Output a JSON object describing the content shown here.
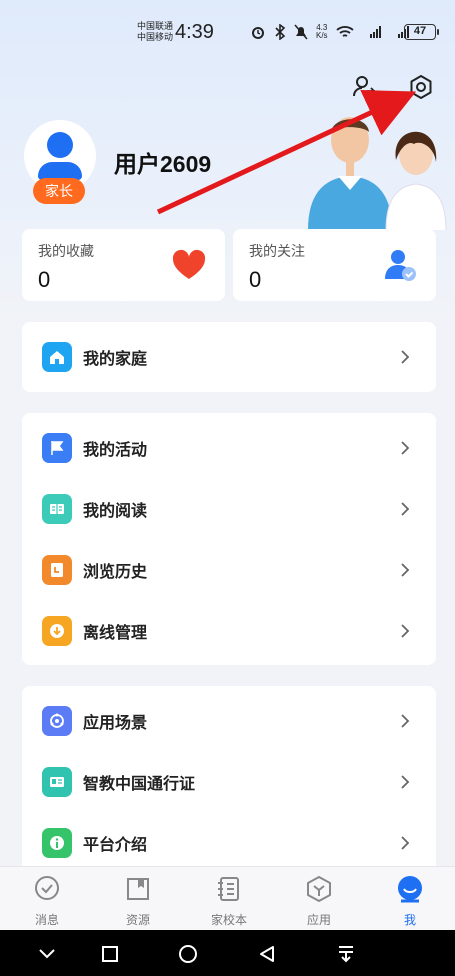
{
  "status_bar": {
    "carrier_top": "中国联通",
    "carrier_bottom": "中国移动",
    "time": "4:39",
    "speed_value": "4.3",
    "speed_unit": "K/s",
    "battery": "47"
  },
  "header_icons": {
    "account_switch": "account-switch-icon",
    "settings": "settings-icon"
  },
  "profile": {
    "username": "用户2609",
    "role_badge": "家长"
  },
  "stats": [
    {
      "label": "我的收藏",
      "value": "0",
      "icon": "heart-icon"
    },
    {
      "label": "我的关注",
      "value": "0",
      "icon": "followed-user-icon"
    }
  ],
  "menu_groups": [
    [
      {
        "label": "我的家庭",
        "icon": "home-icon",
        "color": "#1ea4f0"
      }
    ],
    [
      {
        "label": "我的活动",
        "icon": "flag-icon",
        "color": "#3a7df5"
      },
      {
        "label": "我的阅读",
        "icon": "book-icon",
        "color": "#3ccbb8"
      },
      {
        "label": "浏览历史",
        "icon": "history-icon",
        "color": "#f28a2c"
      },
      {
        "label": "离线管理",
        "icon": "download-icon",
        "color": "#f6a623"
      }
    ],
    [
      {
        "label": "应用场景",
        "icon": "scene-icon",
        "color": "#5b7cf5"
      },
      {
        "label": "智教中国通行证",
        "icon": "id-card-icon",
        "color": "#2fc3b0"
      },
      {
        "label": "平台介绍",
        "icon": "info-icon",
        "color": "#35c46a"
      }
    ]
  ],
  "bottom_nav": [
    {
      "label": "消息",
      "icon": "message-icon"
    },
    {
      "label": "资源",
      "icon": "resource-icon"
    },
    {
      "label": "家校本",
      "icon": "notebook-icon"
    },
    {
      "label": "应用",
      "icon": "apps-icon"
    },
    {
      "label": "我",
      "icon": "me-icon",
      "active": true
    }
  ],
  "colors": {
    "accent": "#1f6ff2",
    "badge": "#ff6a1e",
    "arrow": "#e3191c"
  }
}
